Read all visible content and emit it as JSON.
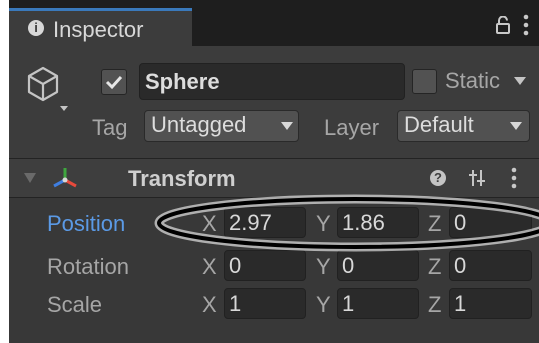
{
  "tab": {
    "icon": "info-icon",
    "icon_glyph": "i",
    "label": "Inspector"
  },
  "header_icons": {
    "lock": "lock-icon",
    "menu": "kebab-menu-icon"
  },
  "gameobject": {
    "icon": "cube-icon",
    "active": true,
    "active_glyph": "✔",
    "name": "Sphere",
    "static_checked": false,
    "static_label": "Static",
    "tag_label": "Tag",
    "tag_value": "Untagged",
    "layer_label": "Layer",
    "layer_value": "Default"
  },
  "transform": {
    "title": "Transform",
    "icon": "transform-gizmo-icon",
    "expanded": true,
    "help_glyph": "?",
    "rows": [
      {
        "label": "Position",
        "x": "2.97",
        "y": "1.86",
        "z": "0",
        "highlighted": true
      },
      {
        "label": "Rotation",
        "x": "0",
        "y": "0",
        "z": "0"
      },
      {
        "label": "Scale",
        "x": "1",
        "y": "1",
        "z": "1"
      }
    ],
    "axis_labels": {
      "x": "X",
      "y": "Y",
      "z": "Z"
    }
  },
  "colors": {
    "selected_label": "#5b9ae6",
    "panel_bg": "#383838",
    "field_bg": "#2a2a2a",
    "tab_accent": "#3a79bb"
  }
}
